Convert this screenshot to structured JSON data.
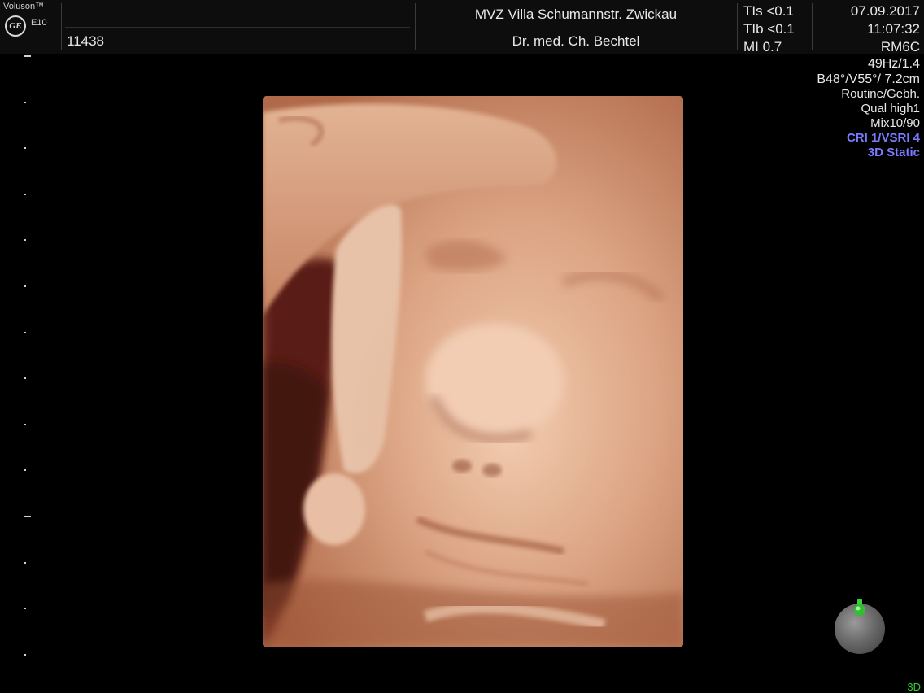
{
  "header": {
    "brand": "Voluson™",
    "logo_text": "GE",
    "model": "E10",
    "patient_id": "11438",
    "clinic": "MVZ Villa Schumannstr. Zwickau",
    "doctor": "Dr. med. Ch. Bechtel",
    "safety": {
      "tis": "TIs <0.1",
      "tib": "TIb <0.1",
      "mi": "MI  0.7"
    },
    "date": "07.09.2017",
    "time": "11:07:32",
    "probe": "RM6C"
  },
  "params": {
    "frame_rate": "49Hz/1.4",
    "volume": "B48°/V55°/ 7.2cm",
    "preset": "Routine/Gebh.",
    "quality": "Qual high1",
    "mix": "Mix10/90",
    "cri": "CRI 1/VSRI 4",
    "render_mode": "3D Static"
  },
  "footer": {
    "mode": "3D"
  },
  "colors": {
    "background": "#000000",
    "accent_blue": "#7b7bff",
    "mode_green": "#2fd02f",
    "tissue": "#d6a182"
  },
  "icons": {
    "orientation": "orientation-sphere-icon",
    "logo": "ge-logo-icon"
  }
}
